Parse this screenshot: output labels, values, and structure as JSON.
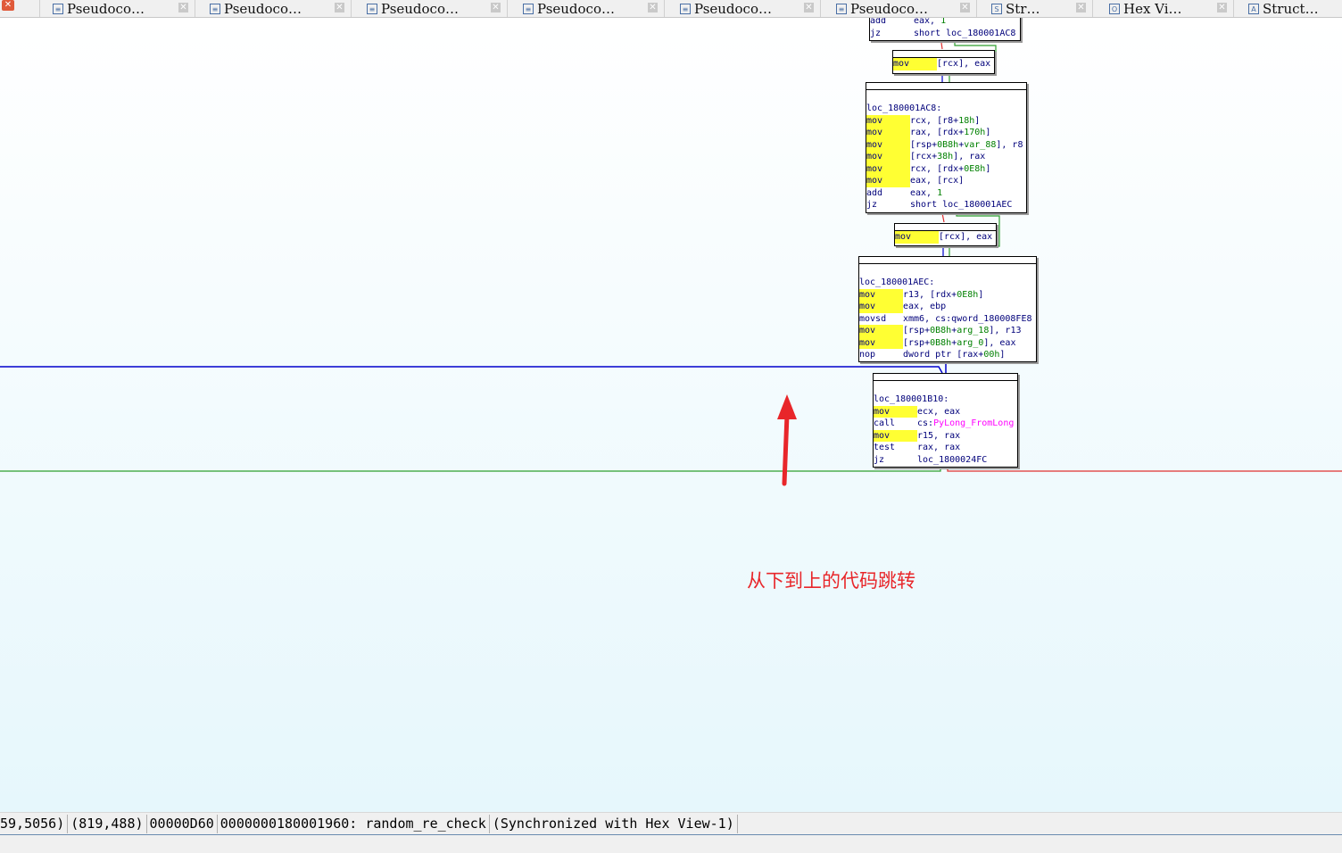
{
  "tabs": [
    {
      "label": "Pseudoco…",
      "icon": "pseudocode-icon",
      "glyph": "≡"
    },
    {
      "label": "Pseudoco…",
      "icon": "pseudocode-icon",
      "glyph": "≡"
    },
    {
      "label": "Pseudoco…",
      "icon": "pseudocode-icon",
      "glyph": "≡"
    },
    {
      "label": "Pseudoco…",
      "icon": "pseudocode-icon",
      "glyph": "≡"
    },
    {
      "label": "Pseudoco…",
      "icon": "pseudocode-icon",
      "glyph": "≡"
    },
    {
      "label": "Pseudoco…",
      "icon": "pseudocode-icon",
      "glyph": "≡"
    },
    {
      "label": "Str…",
      "icon": "strings-icon",
      "glyph": "S"
    },
    {
      "label": "Hex Vi…",
      "icon": "hex-view-icon",
      "glyph": "O"
    },
    {
      "label": "Struct…",
      "icon": "structures-icon",
      "glyph": "A"
    }
  ],
  "nodes": [
    {
      "id": "node0",
      "lines": [
        {
          "mn": "add",
          "hl": false,
          "ops": [
            {
              "t": "eax, "
            },
            {
              "t": "1",
              "c": "num"
            }
          ]
        },
        {
          "mn": "jz",
          "hl": false,
          "ops": [
            {
              "t": "short loc_180001AC8"
            }
          ]
        }
      ]
    },
    {
      "id": "node1",
      "lines": [
        {
          "mn": "mov",
          "hl": true,
          "ops": [
            {
              "t": "[rcx], eax"
            }
          ]
        }
      ]
    },
    {
      "id": "node2",
      "lines": [
        {
          "label": "loc_180001AC8:"
        },
        {
          "mn": "mov",
          "hl": true,
          "ops": [
            {
              "t": "rcx, [r8+"
            },
            {
              "t": "18h",
              "c": "num"
            },
            {
              "t": "]"
            }
          ]
        },
        {
          "mn": "mov",
          "hl": true,
          "ops": [
            {
              "t": "rax, [rdx+"
            },
            {
              "t": "170h",
              "c": "num"
            },
            {
              "t": "]"
            }
          ]
        },
        {
          "mn": "mov",
          "hl": true,
          "ops": [
            {
              "t": "[rsp+"
            },
            {
              "t": "0B8h",
              "c": "num"
            },
            {
              "t": "+"
            },
            {
              "t": "var_88",
              "c": "num"
            },
            {
              "t": "], r8"
            }
          ]
        },
        {
          "mn": "mov",
          "hl": true,
          "ops": [
            {
              "t": "[rcx+"
            },
            {
              "t": "38h",
              "c": "num"
            },
            {
              "t": "], rax"
            }
          ]
        },
        {
          "mn": "mov",
          "hl": true,
          "ops": [
            {
              "t": "rcx, [rdx+"
            },
            {
              "t": "0E8h",
              "c": "num"
            },
            {
              "t": "]"
            }
          ]
        },
        {
          "mn": "mov",
          "hl": true,
          "ops": [
            {
              "t": "eax, [rcx]"
            }
          ]
        },
        {
          "mn": "add",
          "hl": false,
          "ops": [
            {
              "t": "eax, "
            },
            {
              "t": "1",
              "c": "num"
            }
          ]
        },
        {
          "mn": "jz",
          "hl": false,
          "ops": [
            {
              "t": "short loc_180001AEC"
            }
          ]
        }
      ]
    },
    {
      "id": "node3",
      "lines": [
        {
          "mn": "mov",
          "hl": true,
          "ops": [
            {
              "t": "[rcx], eax"
            }
          ]
        }
      ]
    },
    {
      "id": "node4",
      "lines": [
        {
          "label": "loc_180001AEC:"
        },
        {
          "mn": "mov",
          "hl": true,
          "ops": [
            {
              "t": "r13, [rdx+"
            },
            {
              "t": "0E8h",
              "c": "num"
            },
            {
              "t": "]"
            }
          ]
        },
        {
          "mn": "mov",
          "hl": true,
          "ops": [
            {
              "t": "eax, ebp"
            }
          ]
        },
        {
          "mn": "movsd",
          "hl": false,
          "ops": [
            {
              "t": "xmm6, cs:qword_180008FE8"
            }
          ]
        },
        {
          "mn": "mov",
          "hl": true,
          "ops": [
            {
              "t": "[rsp+"
            },
            {
              "t": "0B8h",
              "c": "num"
            },
            {
              "t": "+"
            },
            {
              "t": "arg_18",
              "c": "num"
            },
            {
              "t": "], r13"
            }
          ]
        },
        {
          "mn": "mov",
          "hl": true,
          "ops": [
            {
              "t": "[rsp+"
            },
            {
              "t": "0B8h",
              "c": "num"
            },
            {
              "t": "+"
            },
            {
              "t": "arg_0",
              "c": "num"
            },
            {
              "t": "], eax"
            }
          ]
        },
        {
          "mn": "nop",
          "hl": false,
          "ops": [
            {
              "t": "dword ptr [rax+"
            },
            {
              "t": "00h",
              "c": "num"
            },
            {
              "t": "]"
            }
          ]
        }
      ]
    },
    {
      "id": "node5",
      "lines": [
        {
          "label": "loc_180001B10:"
        },
        {
          "mn": "mov",
          "hl": true,
          "ops": [
            {
              "t": "ecx, eax"
            }
          ]
        },
        {
          "mn": "call",
          "hl": false,
          "ops": [
            {
              "t": "cs:"
            },
            {
              "t": "PyLong_FromLong",
              "c": "imp"
            }
          ]
        },
        {
          "mn": "mov",
          "hl": true,
          "ops": [
            {
              "t": "r15, rax"
            }
          ]
        },
        {
          "mn": "test",
          "hl": false,
          "ops": [
            {
              "t": "rax, rax"
            }
          ]
        },
        {
          "mn": "jz",
          "hl": false,
          "ops": [
            {
              "t": "loc_1800024FC"
            }
          ]
        }
      ]
    }
  ],
  "annotation": {
    "text": "从下到上的代码跳转",
    "color": "#e8262a"
  },
  "status": {
    "seg1": "59,5056)",
    "seg2": "(819,488)",
    "seg3": "00000D60",
    "seg4": "0000000180001960: random_re_check",
    "seg5": "(Synchronized with Hex View-1)"
  },
  "colors": {
    "back_edge": "#0000cc",
    "true_edge": "#2e9e2e",
    "false_edge": "#e03030",
    "highlight": "#ffff33"
  }
}
